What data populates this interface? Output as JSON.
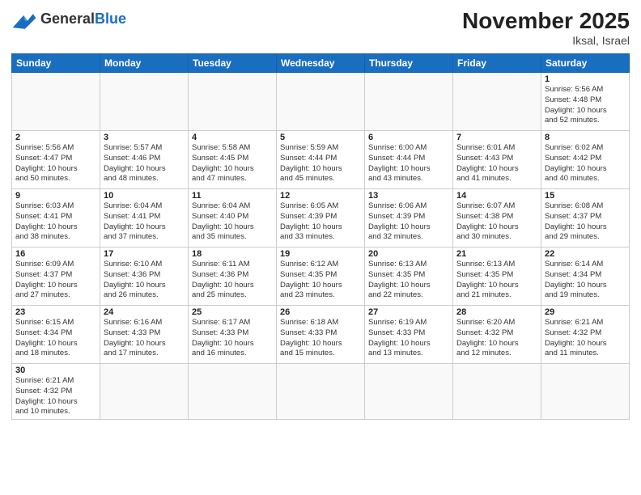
{
  "header": {
    "logo_general": "General",
    "logo_blue": "Blue",
    "month_title": "November 2025",
    "location": "Iksal, Israel"
  },
  "weekdays": [
    "Sunday",
    "Monday",
    "Tuesday",
    "Wednesday",
    "Thursday",
    "Friday",
    "Saturday"
  ],
  "weeks": [
    [
      {
        "day": "",
        "info": ""
      },
      {
        "day": "",
        "info": ""
      },
      {
        "day": "",
        "info": ""
      },
      {
        "day": "",
        "info": ""
      },
      {
        "day": "",
        "info": ""
      },
      {
        "day": "",
        "info": ""
      },
      {
        "day": "1",
        "info": "Sunrise: 5:56 AM\nSunset: 4:48 PM\nDaylight: 10 hours\nand 52 minutes."
      }
    ],
    [
      {
        "day": "2",
        "info": "Sunrise: 5:56 AM\nSunset: 4:47 PM\nDaylight: 10 hours\nand 50 minutes."
      },
      {
        "day": "3",
        "info": "Sunrise: 5:57 AM\nSunset: 4:46 PM\nDaylight: 10 hours\nand 48 minutes."
      },
      {
        "day": "4",
        "info": "Sunrise: 5:58 AM\nSunset: 4:45 PM\nDaylight: 10 hours\nand 47 minutes."
      },
      {
        "day": "5",
        "info": "Sunrise: 5:59 AM\nSunset: 4:44 PM\nDaylight: 10 hours\nand 45 minutes."
      },
      {
        "day": "6",
        "info": "Sunrise: 6:00 AM\nSunset: 4:44 PM\nDaylight: 10 hours\nand 43 minutes."
      },
      {
        "day": "7",
        "info": "Sunrise: 6:01 AM\nSunset: 4:43 PM\nDaylight: 10 hours\nand 41 minutes."
      },
      {
        "day": "8",
        "info": "Sunrise: 6:02 AM\nSunset: 4:42 PM\nDaylight: 10 hours\nand 40 minutes."
      }
    ],
    [
      {
        "day": "9",
        "info": "Sunrise: 6:03 AM\nSunset: 4:41 PM\nDaylight: 10 hours\nand 38 minutes."
      },
      {
        "day": "10",
        "info": "Sunrise: 6:04 AM\nSunset: 4:41 PM\nDaylight: 10 hours\nand 37 minutes."
      },
      {
        "day": "11",
        "info": "Sunrise: 6:04 AM\nSunset: 4:40 PM\nDaylight: 10 hours\nand 35 minutes."
      },
      {
        "day": "12",
        "info": "Sunrise: 6:05 AM\nSunset: 4:39 PM\nDaylight: 10 hours\nand 33 minutes."
      },
      {
        "day": "13",
        "info": "Sunrise: 6:06 AM\nSunset: 4:39 PM\nDaylight: 10 hours\nand 32 minutes."
      },
      {
        "day": "14",
        "info": "Sunrise: 6:07 AM\nSunset: 4:38 PM\nDaylight: 10 hours\nand 30 minutes."
      },
      {
        "day": "15",
        "info": "Sunrise: 6:08 AM\nSunset: 4:37 PM\nDaylight: 10 hours\nand 29 minutes."
      }
    ],
    [
      {
        "day": "16",
        "info": "Sunrise: 6:09 AM\nSunset: 4:37 PM\nDaylight: 10 hours\nand 27 minutes."
      },
      {
        "day": "17",
        "info": "Sunrise: 6:10 AM\nSunset: 4:36 PM\nDaylight: 10 hours\nand 26 minutes."
      },
      {
        "day": "18",
        "info": "Sunrise: 6:11 AM\nSunset: 4:36 PM\nDaylight: 10 hours\nand 25 minutes."
      },
      {
        "day": "19",
        "info": "Sunrise: 6:12 AM\nSunset: 4:35 PM\nDaylight: 10 hours\nand 23 minutes."
      },
      {
        "day": "20",
        "info": "Sunrise: 6:13 AM\nSunset: 4:35 PM\nDaylight: 10 hours\nand 22 minutes."
      },
      {
        "day": "21",
        "info": "Sunrise: 6:13 AM\nSunset: 4:35 PM\nDaylight: 10 hours\nand 21 minutes."
      },
      {
        "day": "22",
        "info": "Sunrise: 6:14 AM\nSunset: 4:34 PM\nDaylight: 10 hours\nand 19 minutes."
      }
    ],
    [
      {
        "day": "23",
        "info": "Sunrise: 6:15 AM\nSunset: 4:34 PM\nDaylight: 10 hours\nand 18 minutes."
      },
      {
        "day": "24",
        "info": "Sunrise: 6:16 AM\nSunset: 4:33 PM\nDaylight: 10 hours\nand 17 minutes."
      },
      {
        "day": "25",
        "info": "Sunrise: 6:17 AM\nSunset: 4:33 PM\nDaylight: 10 hours\nand 16 minutes."
      },
      {
        "day": "26",
        "info": "Sunrise: 6:18 AM\nSunset: 4:33 PM\nDaylight: 10 hours\nand 15 minutes."
      },
      {
        "day": "27",
        "info": "Sunrise: 6:19 AM\nSunset: 4:33 PM\nDaylight: 10 hours\nand 13 minutes."
      },
      {
        "day": "28",
        "info": "Sunrise: 6:20 AM\nSunset: 4:32 PM\nDaylight: 10 hours\nand 12 minutes."
      },
      {
        "day": "29",
        "info": "Sunrise: 6:21 AM\nSunset: 4:32 PM\nDaylight: 10 hours\nand 11 minutes."
      }
    ],
    [
      {
        "day": "30",
        "info": "Sunrise: 6:21 AM\nSunset: 4:32 PM\nDaylight: 10 hours\nand 10 minutes."
      },
      {
        "day": "",
        "info": ""
      },
      {
        "day": "",
        "info": ""
      },
      {
        "day": "",
        "info": ""
      },
      {
        "day": "",
        "info": ""
      },
      {
        "day": "",
        "info": ""
      },
      {
        "day": "",
        "info": ""
      }
    ]
  ]
}
